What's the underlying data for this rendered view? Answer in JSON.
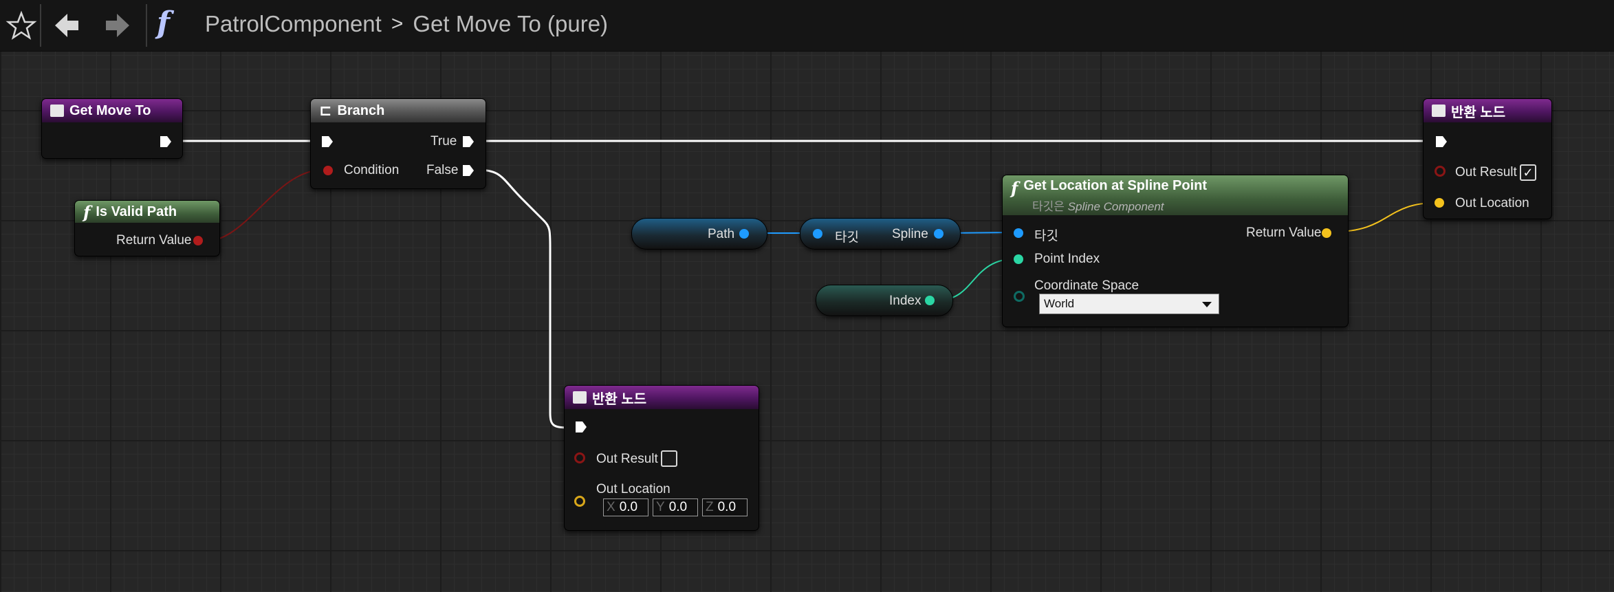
{
  "toolbar": {
    "icons": [
      "star-icon",
      "back-arrow-icon",
      "forward-arrow-icon",
      "function-icon"
    ],
    "function_glyph": "f"
  },
  "breadcrumb": {
    "parent": "PatrolComponent",
    "separator": ">",
    "current": "Get Move To (pure)"
  },
  "nodes": {
    "entry": {
      "title": "Get Move To"
    },
    "is_valid_path": {
      "title": "Is Valid Path",
      "return_label": "Return Value"
    },
    "branch": {
      "title": "Branch",
      "condition": "Condition",
      "true_label": "True",
      "false_label": "False"
    },
    "return_top": {
      "title": "반환 노드",
      "out_result": "Out Result",
      "out_location": "Out Location",
      "out_result_checked": true
    },
    "get_location": {
      "title": "Get Location at Spline Point",
      "subtitle_prefix": "타깃은 ",
      "subtitle_target": "Spline Component",
      "target_pin": "타깃",
      "point_index": "Point Index",
      "coordinate_space": "Coordinate Space",
      "coordinate_value": "World",
      "return_label": "Return Value"
    },
    "return_bottom": {
      "title": "반환 노드",
      "out_result": "Out Result",
      "out_location": "Out Location",
      "out_result_checked": false,
      "x_axis": "X",
      "x": "0.0",
      "y_axis": "Y",
      "y": "0.0",
      "z_axis": "Z",
      "z": "0.0"
    }
  },
  "variables": {
    "path": "Path",
    "spline_getter_target": "타깃",
    "spline": "Spline",
    "index": "Index"
  },
  "colors": {
    "exec": "#ffffff",
    "bool": "#9b1b1b",
    "object": "#1e9bff",
    "int": "#2bd6a4",
    "vector": "#f4c21d",
    "purple_header": "#6a2379",
    "function_header": "#4f7449"
  }
}
